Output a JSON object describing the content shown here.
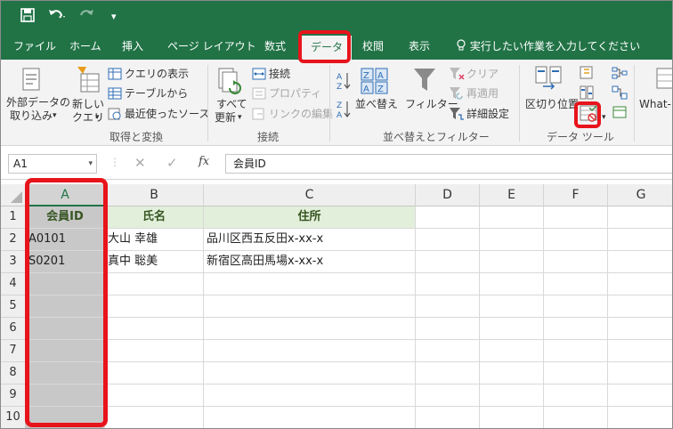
{
  "tabs": [
    {
      "label": "ファイル"
    },
    {
      "label": "ホーム"
    },
    {
      "label": "挿入"
    },
    {
      "label": "ページ レイアウト"
    },
    {
      "label": "数式"
    },
    {
      "label": "データ"
    },
    {
      "label": "校閲"
    },
    {
      "label": "表示"
    }
  ],
  "tell_me": "実行したい作業を入力してください",
  "ribbon": {
    "external_data": [
      "外部データの",
      "取り込み"
    ],
    "new_query": [
      "新しい",
      "クエリ"
    ],
    "show_queries": "クエリの表示",
    "from_table": "テーブルから",
    "recent_sources": "最近使ったソース",
    "group_get_transform": "取得と変換",
    "refresh_all": [
      "すべて",
      "更新"
    ],
    "connections": "接続",
    "properties": "プロパティ",
    "edit_links": "リンクの編集",
    "group_connections": "接続",
    "sort_az": "並べ替え",
    "filter": "フィルター",
    "clear": "クリア",
    "reapply": "再適用",
    "advanced": "詳細設定",
    "group_sort_filter": "並べ替えとフィルター",
    "text_to_columns": "区切り位置",
    "group_data_tools": "データ ツール",
    "whatif": "What-I"
  },
  "formula_bar": {
    "name_box": "A1",
    "fx": "fx",
    "content": "会員ID"
  },
  "columns": [
    "A",
    "B",
    "C",
    "D",
    "E",
    "F",
    "G"
  ],
  "rows": [
    "1",
    "2",
    "3",
    "4",
    "5",
    "6",
    "7",
    "8",
    "9",
    "10"
  ],
  "sheet": {
    "header": [
      "会員ID",
      "氏名",
      "住所"
    ],
    "data": [
      [
        "A0101",
        "大山 幸雄",
        "品川区西五反田x-xx-x"
      ],
      [
        "S0201",
        "真中 聡美",
        "新宿区高田馬場x-xx-x"
      ]
    ]
  },
  "colors": {
    "excel_green": "#217346",
    "highlight": "#e8141b"
  }
}
